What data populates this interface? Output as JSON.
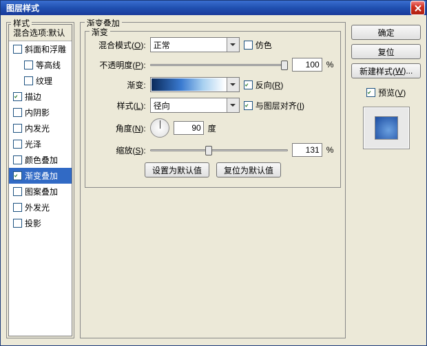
{
  "window": {
    "title": "图层样式"
  },
  "sidebar": {
    "header": "样式",
    "blend_default": "混合选项:默认",
    "items": [
      {
        "label": "斜面和浮雕",
        "checked": false,
        "indent": false
      },
      {
        "label": "等高线",
        "checked": false,
        "indent": true
      },
      {
        "label": "纹理",
        "checked": false,
        "indent": true
      },
      {
        "label": "描边",
        "checked": true,
        "indent": false
      },
      {
        "label": "内阴影",
        "checked": false,
        "indent": false
      },
      {
        "label": "内发光",
        "checked": false,
        "indent": false
      },
      {
        "label": "光泽",
        "checked": false,
        "indent": false
      },
      {
        "label": "颜色叠加",
        "checked": false,
        "indent": false
      },
      {
        "label": "渐变叠加",
        "checked": true,
        "indent": false,
        "selected": true
      },
      {
        "label": "图案叠加",
        "checked": false,
        "indent": false
      },
      {
        "label": "外发光",
        "checked": false,
        "indent": false
      },
      {
        "label": "投影",
        "checked": false,
        "indent": false
      }
    ]
  },
  "panel": {
    "group_title": "渐变叠加",
    "subgroup_title": "渐变",
    "blend_mode": {
      "label_pre": "混合模式(",
      "key": "O",
      "label_post": "):",
      "value": "正常"
    },
    "dither": {
      "label": "仿色",
      "checked": false
    },
    "opacity": {
      "label_pre": "不透明度(",
      "key": "P",
      "label_post": "):",
      "value": "100",
      "unit": "%"
    },
    "gradient": {
      "label_pre": "渐变",
      "label_post": ":"
    },
    "reverse": {
      "label_pre": "反向(",
      "key": "R",
      "label_post": ")",
      "checked": true
    },
    "style": {
      "label_pre": "样式(",
      "key": "L",
      "label_post": "):",
      "value": "径向"
    },
    "align": {
      "label_pre": "与图层对齐(",
      "key": "I",
      "label_post": ")",
      "checked": true
    },
    "angle": {
      "label_pre": "角度(",
      "key": "N",
      "label_post": "):",
      "value": "90",
      "unit": "度"
    },
    "scale": {
      "label_pre": "缩放(",
      "key": "S",
      "label_post": "):",
      "value": "131",
      "unit": "%"
    },
    "defaults": {
      "set": "设置为默认值",
      "reset": "复位为默认值"
    }
  },
  "buttons": {
    "ok": "确定",
    "cancel": "复位",
    "new_style_pre": "新建样式(",
    "new_style_key": "W",
    "new_style_post": ")...",
    "preview_pre": "预览(",
    "preview_key": "V",
    "preview_post": ")",
    "preview_checked": true
  }
}
